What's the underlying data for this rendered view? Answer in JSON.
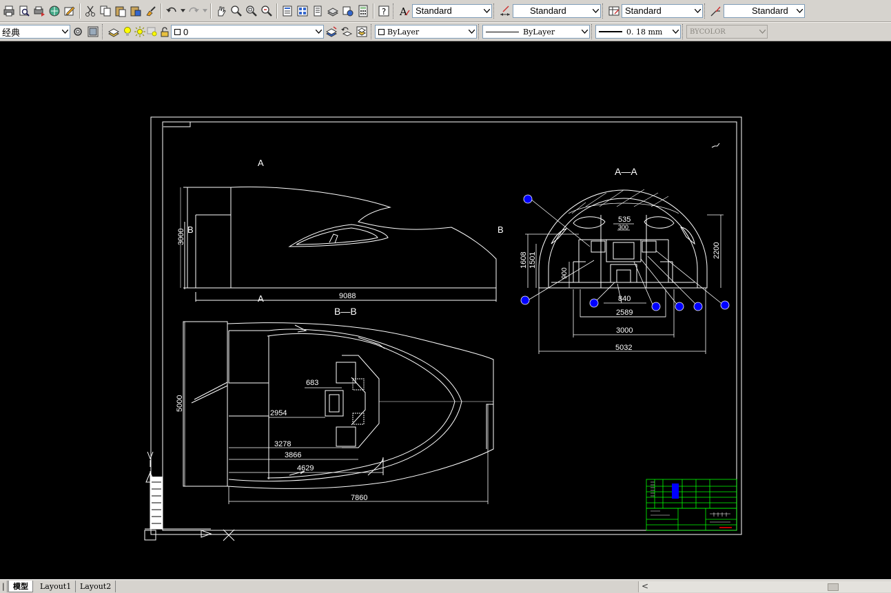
{
  "toolbar1": {
    "text_style": "Standard",
    "dim_style": "Standard",
    "table_style": "Standard",
    "mleader_style": "Standard"
  },
  "toolbar2": {
    "workspace": "经典",
    "layer": "0",
    "color": "ByLayer",
    "linetype": "ByLayer",
    "lineweight": "0. 18  mm",
    "plotstyle": "BYCOLOR"
  },
  "drawing": {
    "section_labels": {
      "aa": "A—A",
      "bb": "B—B",
      "a_top": "A",
      "a_bottom": "A",
      "b_left": "B",
      "b_right": "B"
    },
    "side_view_dims": {
      "height": "3000",
      "length": "9088"
    },
    "aa_dims": {
      "d535": "535",
      "d300": "300",
      "d1608": "1608",
      "d1501": "1501",
      "d2200": "2200",
      "d900": "900",
      "d840": "840",
      "d2589": "2589",
      "d3000": "3000",
      "d5032": "5032"
    },
    "bb_dims": {
      "d683": "683",
      "d2954": "2954",
      "d3278": "3278",
      "d3866": "3866",
      "d4629": "4629",
      "d5000": "5000",
      "d7860": "7860"
    }
  },
  "tabs": {
    "model": "模型",
    "layout1": "Layout1",
    "layout2": "Layout2"
  },
  "colors": {
    "toolbar": "#d6d3ce",
    "canvas": "#000000",
    "line": "#ffffff",
    "title_block": "#00ff00",
    "accent": "#0000ff"
  }
}
